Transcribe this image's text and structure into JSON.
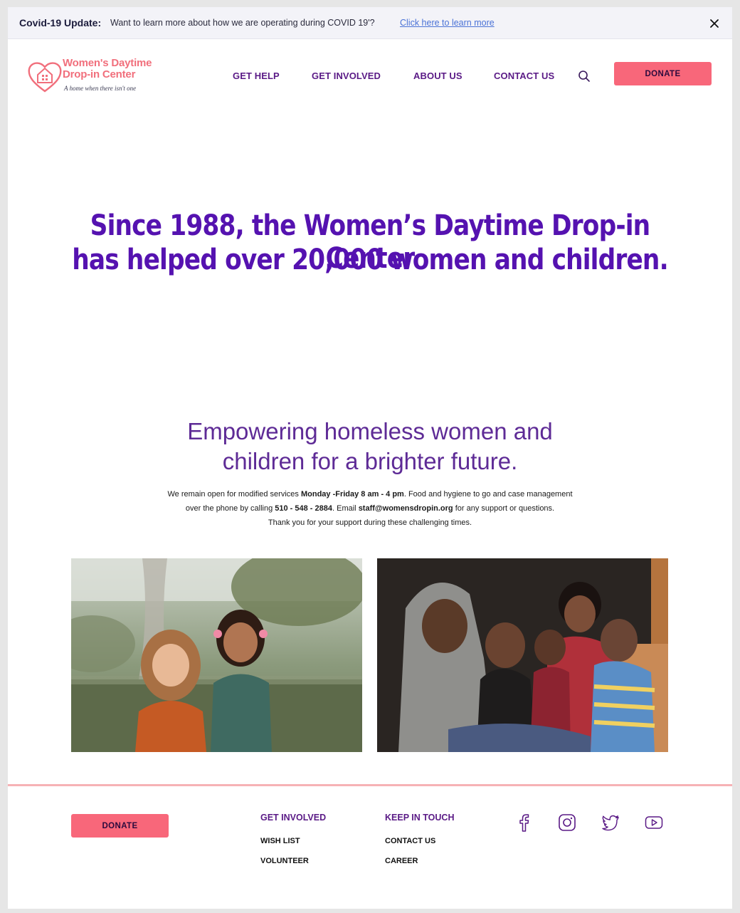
{
  "banner": {
    "title": "Covid-19 Update:",
    "text": "Want to learn more about how we are operating during  COVID 19'?",
    "link": "Click here to learn more",
    "close_icon": "close-icon"
  },
  "logo": {
    "name_line1": "Women's Daytime",
    "name_line2": "Drop-in Center",
    "tagline": "A home when there isn't one",
    "icon": "heart-house-icon"
  },
  "nav": {
    "items": [
      "GET HELP",
      "GET INVOLVED",
      "ABOUT US",
      "CONTACT US"
    ],
    "search_icon": "search-icon",
    "donate": "DONATE"
  },
  "hero": {
    "line1": "Since 1988, the Women’s Daytime Drop-in Center",
    "line2": "has helped over 20,000 women and children."
  },
  "mission": {
    "line1": "Empowering homeless women and",
    "line2": "children for a brighter future.",
    "info1_pre": "We remain open for modified services ",
    "info1_bold": "Monday -Friday 8 am - 4 pm",
    "info1_post": ".  Food and hygiene to go and case management",
    "info2_pre": "over the phone by calling ",
    "info2_phone": "510 - 548 - 2884",
    "info2_mid": ". Email ",
    "info2_email": "staff@womensdropin.org",
    "info2_post": " for any support or questions.",
    "info3": "Thank you for your support during these challenging times."
  },
  "colors": {
    "accent_pink": "#f8677a",
    "brand_purple": "#5512b0",
    "nav_purple": "#5a1a86"
  },
  "footer": {
    "donate": "DONATE",
    "get_involved_title": "GET INVOLVED",
    "get_involved_links": [
      "WISH LIST",
      "VOLUNTEER"
    ],
    "keep_in_touch_title": "KEEP IN TOUCH",
    "keep_in_touch_links": [
      "CONTACT US",
      "CAREER"
    ],
    "social_icons": [
      "facebook-icon",
      "instagram-icon",
      "twitter-icon",
      "youtube-icon"
    ]
  }
}
